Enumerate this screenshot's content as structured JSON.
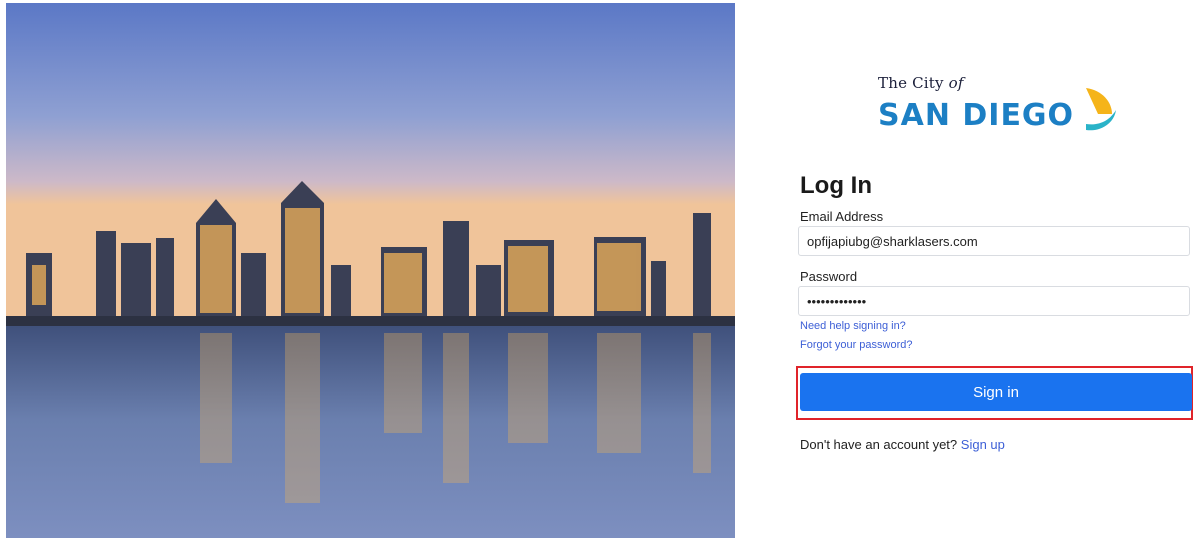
{
  "hero": {
    "image": "san-diego-skyline-at-dusk"
  },
  "logo": {
    "line1": "The City",
    "line1_italic": "of",
    "line2": "SAN DIEGO"
  },
  "form": {
    "title": "Log In",
    "email_label": "Email Address",
    "email_value": "opfijapiubg@sharklasers.com",
    "password_label": "Password",
    "password_value": "•••••••••••••",
    "help_link": "Need help signing in?",
    "forgot_link": "Forgot your password?",
    "signin_label": "Sign in",
    "signup_prompt": "Don't have an account yet?",
    "signup_link": "Sign up"
  },
  "colors": {
    "primary": "#1a73ef",
    "link": "#3d5fd6",
    "highlight": "#e0242a",
    "brand_blue": "#1c7fc4"
  }
}
